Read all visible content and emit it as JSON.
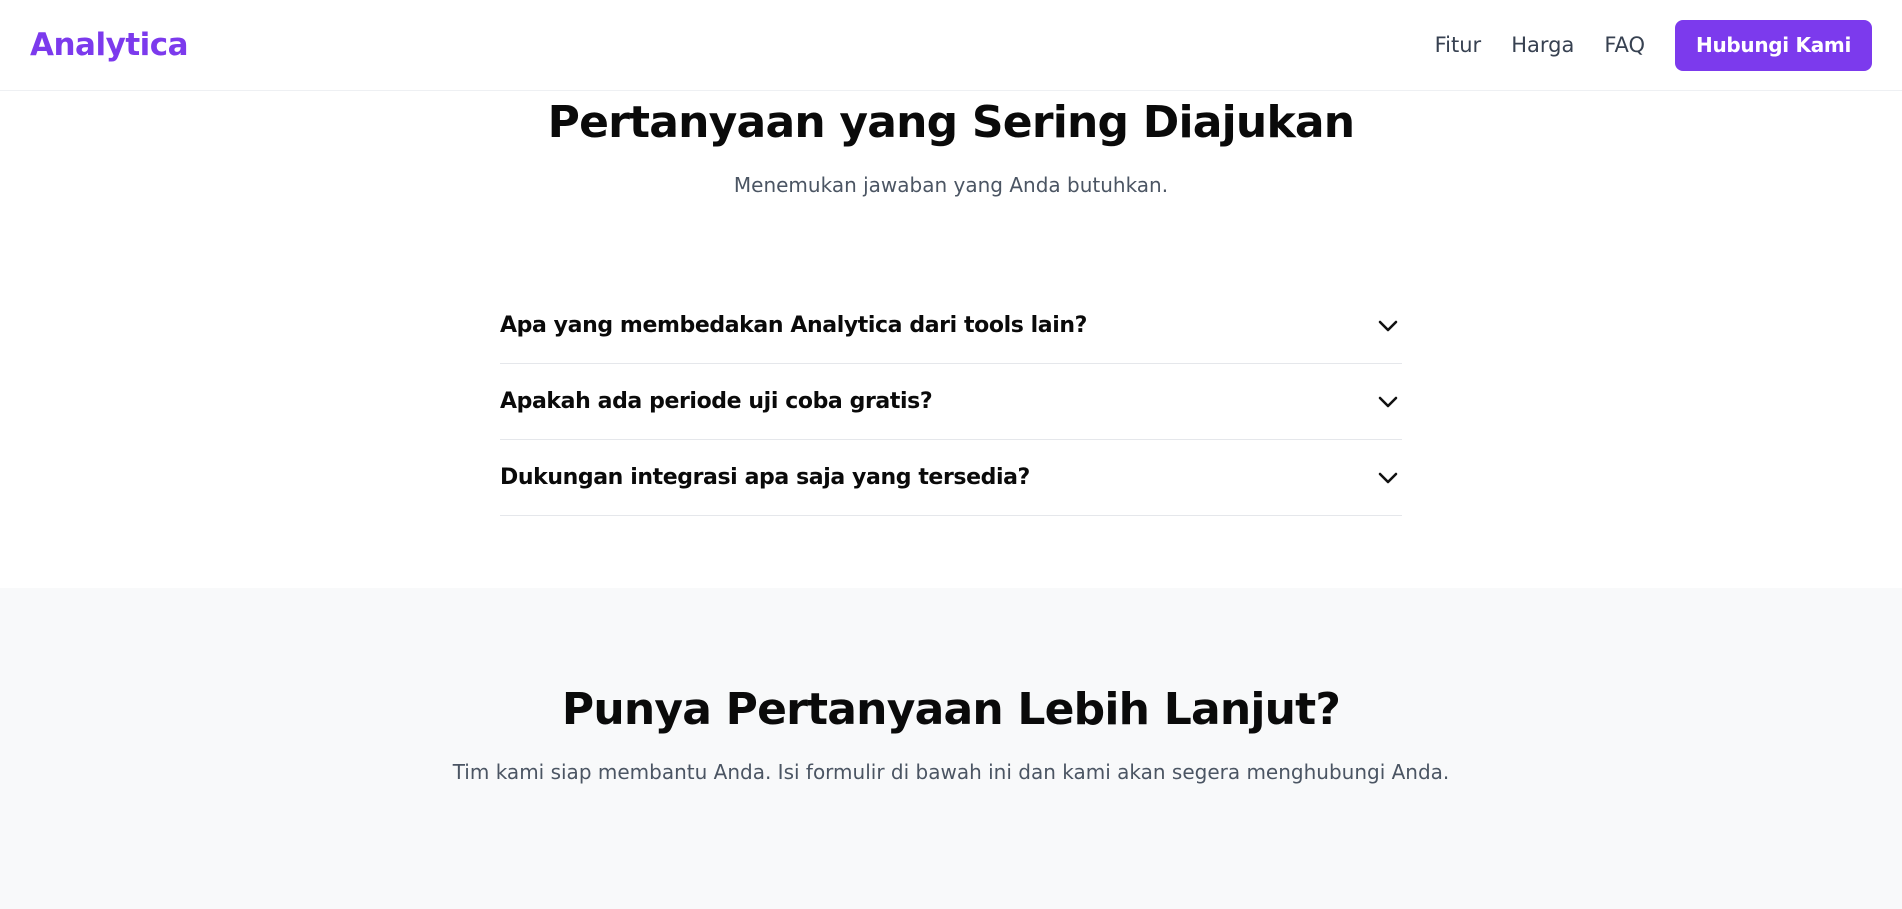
{
  "navbar": {
    "logo": "Analytica",
    "links": [
      {
        "label": "Fitur"
      },
      {
        "label": "Harga"
      },
      {
        "label": "FAQ"
      }
    ],
    "cta_label": "Hubungi Kami"
  },
  "faq": {
    "title": "Pertanyaan yang Sering Diajukan",
    "subtitle": "Menemukan jawaban yang Anda butuhkan.",
    "items": [
      {
        "question": "Apa yang membedakan Analytica dari tools lain?",
        "icon": "chevron-down-icon"
      },
      {
        "question": "Apakah ada periode uji coba gratis?",
        "icon": "chevron-down-icon"
      },
      {
        "question": "Dukungan integrasi apa saja yang tersedia?",
        "icon": "chevron-down-icon"
      }
    ]
  },
  "contact": {
    "title": "Punya Pertanyaan Lebih Lanjut?",
    "subtitle": "Tim kami siap membantu Anda. Isi formulir di bawah ini dan kami akan segera menghubungi Anda."
  },
  "colors": {
    "brand": "#7c3aed",
    "text_dark": "#0a0a0a",
    "text_muted": "#4b5563",
    "section_alt_bg": "#f8f9fa",
    "divider": "#e5e7eb"
  }
}
